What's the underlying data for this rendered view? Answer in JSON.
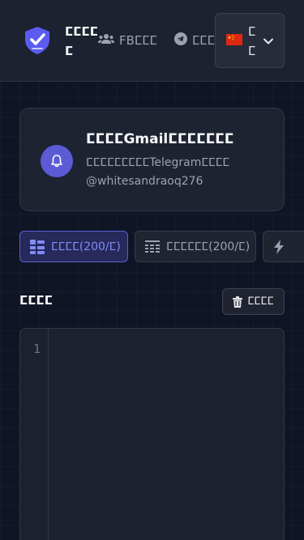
{
  "header": {
    "brand_name": "ⵎⵎⵎⵎⵎ",
    "nav_fb_label": "FBⵎⵎⵎ",
    "nav_tg_label": "ⵎⵎⵎⵎ",
    "language_label": "ⵎⵎ",
    "colors": {
      "brand_shield": "#5b5bf0",
      "flag_red": "#de2910",
      "flag_star": "#ffde00"
    }
  },
  "notice": {
    "title": "ⵎⵎⵎⵎGmailⵎⵎⵎⵎⵎⵎⵎ",
    "line1": "ⵎⵎⵎⵎⵎⵎⵎⵎⵎTelegramⵎⵎⵎⵎ",
    "line2": "@whitesandraoq276"
  },
  "tabs": [
    {
      "label": "ⵎⵎⵎⵎ(200/ⵎ)",
      "icon": "grid-icon",
      "active": true
    },
    {
      "label": "ⵎⵎⵎⵎⵎⵎ(200/ⵎ)",
      "icon": "table-list-icon",
      "active": false
    },
    {
      "label": "",
      "icon": "bolt-icon",
      "active": false
    }
  ],
  "section": {
    "label": "ⵎⵎⵎⵎ",
    "clear_button_label": "ⵎⵎⵎⵎ"
  },
  "editor": {
    "line_number": "1",
    "content": ""
  },
  "theme": {
    "accent": "#5b5fd6",
    "accent_text": "#818cf8",
    "background": "#0f1524"
  }
}
